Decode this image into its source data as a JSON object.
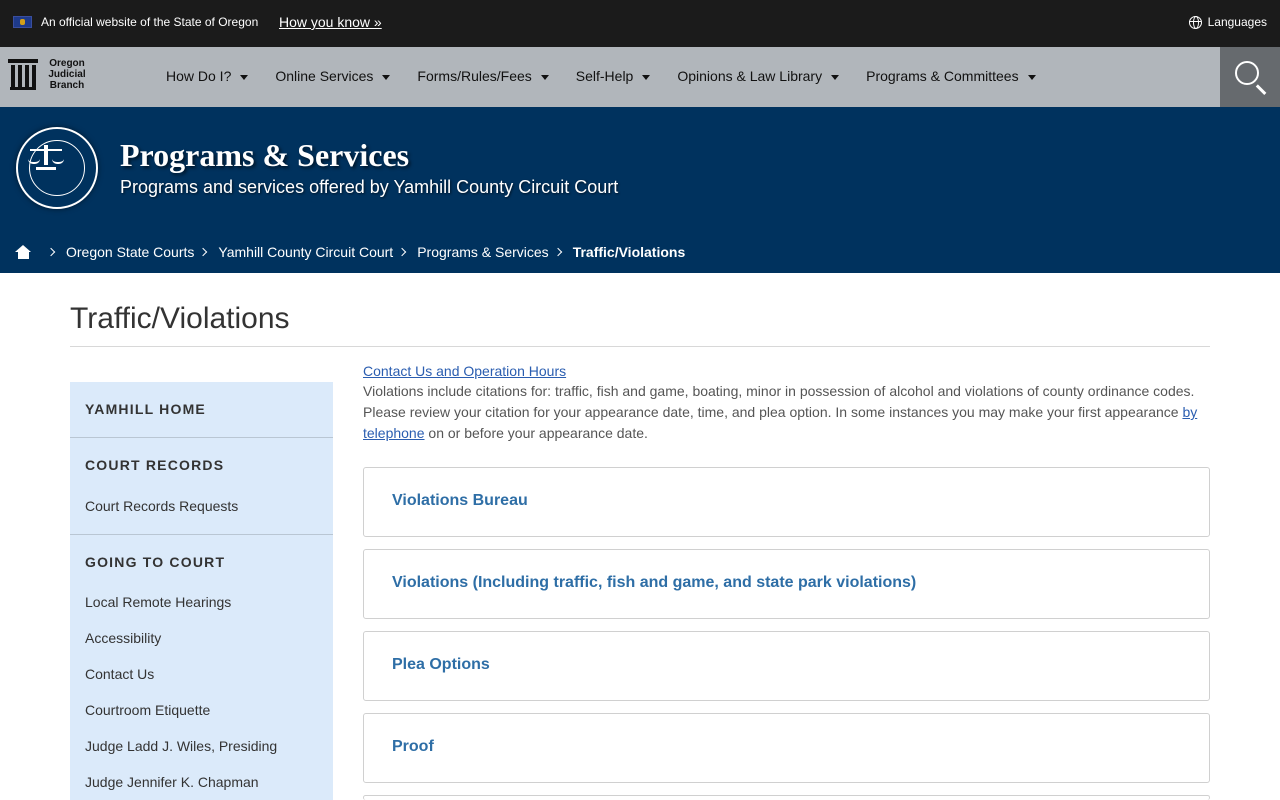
{
  "official_bar": {
    "text": "An official website of the State of Oregon",
    "how_you_know": "How you know »",
    "languages": "Languages"
  },
  "brand": {
    "line1": "Oregon",
    "line2": "Judicial",
    "line3": "Branch"
  },
  "nav": {
    "items": [
      {
        "label": "How Do I?"
      },
      {
        "label": "Online Services"
      },
      {
        "label": "Forms/Rules/Fees"
      },
      {
        "label": "Self-Help"
      },
      {
        "label": "Opinions & Law Library"
      },
      {
        "label": "Programs & Committees"
      }
    ]
  },
  "hero": {
    "title": "Programs & Services",
    "subtitle": "Programs and services offered by Yamhill County Circuit Court"
  },
  "breadcrumb": {
    "items": [
      "Oregon State Courts",
      "Yamhill County Circuit Court",
      "Programs & Services"
    ],
    "current": "Traffic/Violations"
  },
  "page": {
    "title": "Traffic/Violations"
  },
  "sidebar": {
    "home": "YAMHILL HOME",
    "court_records": {
      "heading": "COURT RECORDS",
      "links": [
        "Court Records Requests"
      ]
    },
    "going_to_court": {
      "heading": "GOING TO COURT",
      "links": [
        "Local Remote Hearings",
        "Accessibility",
        "Contact Us",
        "Courtroom Etiquette",
        "Judge Ladd J. Wiles, Presiding",
        "Judge Jennifer K. Chapman"
      ]
    }
  },
  "content": {
    "contact_link": "Contact Us and Operation Hours",
    "para1": "Violations include citations for: traffic, fish and game, boating, minor in possession of alcohol and violations of county ordinance codes.",
    "para2_start": "Please review your citation for your appearance date, time, and plea option. In some instances you may make your first appearance ",
    "para2_link": "by telephone",
    "para2_end": " on or before your appearance date."
  },
  "accordions": [
    {
      "label": "Violations Bureau"
    },
    {
      "label": "Violations (Including traffic, fish and game, and state park violations)"
    },
    {
      "label": "Plea Options"
    },
    {
      "label": "Proof"
    }
  ],
  "colors": {
    "official_bar_bg": "#1b1b1b",
    "nav_bg": "#b1b6bb",
    "hero_bg": "#00325e",
    "sidebar_bg": "#dbeafa",
    "accordion_label": "#2e6ea6",
    "link": "#2a5db0"
  }
}
